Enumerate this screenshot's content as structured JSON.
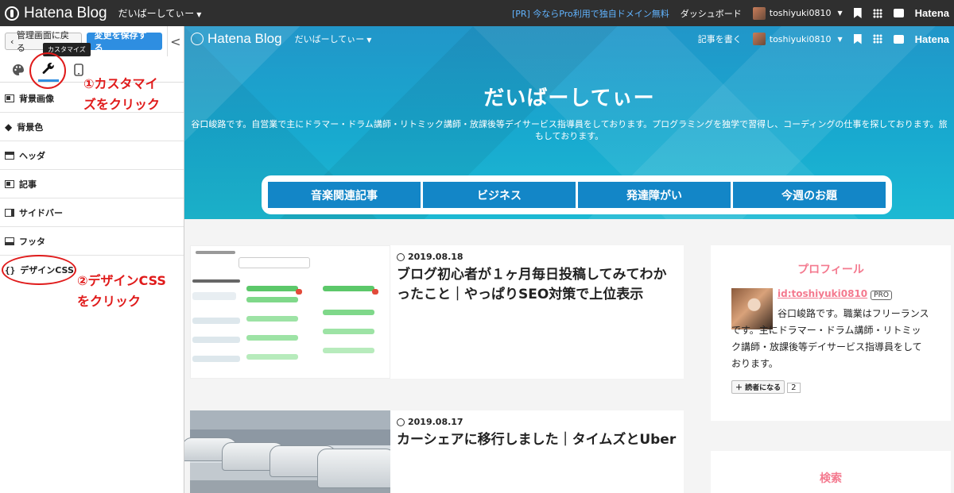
{
  "topbar": {
    "logo": "Hatena Blog",
    "blog_name": "だいばーしてぃー",
    "promo": "[PR] 今ならPro利用で独自ドメイン無料",
    "dashboard": "ダッシュボード",
    "username": "toshiyuki0810",
    "hatena": "Hatena"
  },
  "panel": {
    "back_label": "管理画面に戻る",
    "save_label": "変更を保存する",
    "collapse": "<",
    "tooltip": "カスタマイズ",
    "tabs": [
      {
        "icon": "palette-icon"
      },
      {
        "icon": "wrench-icon"
      },
      {
        "icon": "smartphone-icon"
      }
    ],
    "items": [
      {
        "label": "背景画像",
        "icon": "image-icon"
      },
      {
        "label": "背景色",
        "icon": "paint-bucket-icon"
      },
      {
        "label": "ヘッダ",
        "icon": "header-layout-icon"
      },
      {
        "label": "記事",
        "icon": "article-layout-icon"
      },
      {
        "label": "サイドバー",
        "icon": "sidebar-layout-icon"
      },
      {
        "label": "フッタ",
        "icon": "footer-layout-icon"
      },
      {
        "label": "デザインCSS",
        "icon": "css-braces-icon",
        "prefix": "{}"
      }
    ]
  },
  "annotations": {
    "step1_line1": "①カスタマイ",
    "step1_line2": "ズをクリック",
    "step2_line1": "②デザインCSS",
    "step2_line2": "をクリック",
    "color": "#e01b1b"
  },
  "preview": {
    "logo": "Hatena Blog",
    "blog_name": "だいばーしてぃー",
    "write": "記事を書く",
    "username": "toshiyuki0810",
    "hatena": "Hatena",
    "title": "だいばーしてぃー",
    "description": "谷口峻路です。自営業で主にドラマー・ドラム講師・リトミック講師・放課後等デイサービス指導員をしております。プログラミングを独学で習得し、コーディングの仕事を探しております。旅もしております。",
    "nav": [
      "音楽関連記事",
      "ビジネス",
      "発達障がい",
      "今週のお題"
    ],
    "posts": [
      {
        "date": "2019.08.18",
        "title": "ブログ初心者が１ヶ月毎日投稿してみてわかったこと｜やっぱりSEO対策で上位表示"
      },
      {
        "date": "2019.08.17",
        "title": "カーシェアに移行しました｜タイムズとUber"
      }
    ],
    "sidebar": {
      "profile_title": "プロフィール",
      "profile_id": "id:toshiyuki0810",
      "badge": "PRO",
      "profile_text": "谷口峻路です。職業はフリーランスです。主にドラマー・ドラム講師・リトミック講師・放課後等デイサービス指導員をしております。",
      "reader_button": "読者になる",
      "reader_count": "2",
      "search_title": "検索"
    },
    "colors": {
      "accent": "#1386c7",
      "hero": "#18a9cf",
      "pink": "#f47a8f",
      "save": "#2e8ee1"
    }
  }
}
